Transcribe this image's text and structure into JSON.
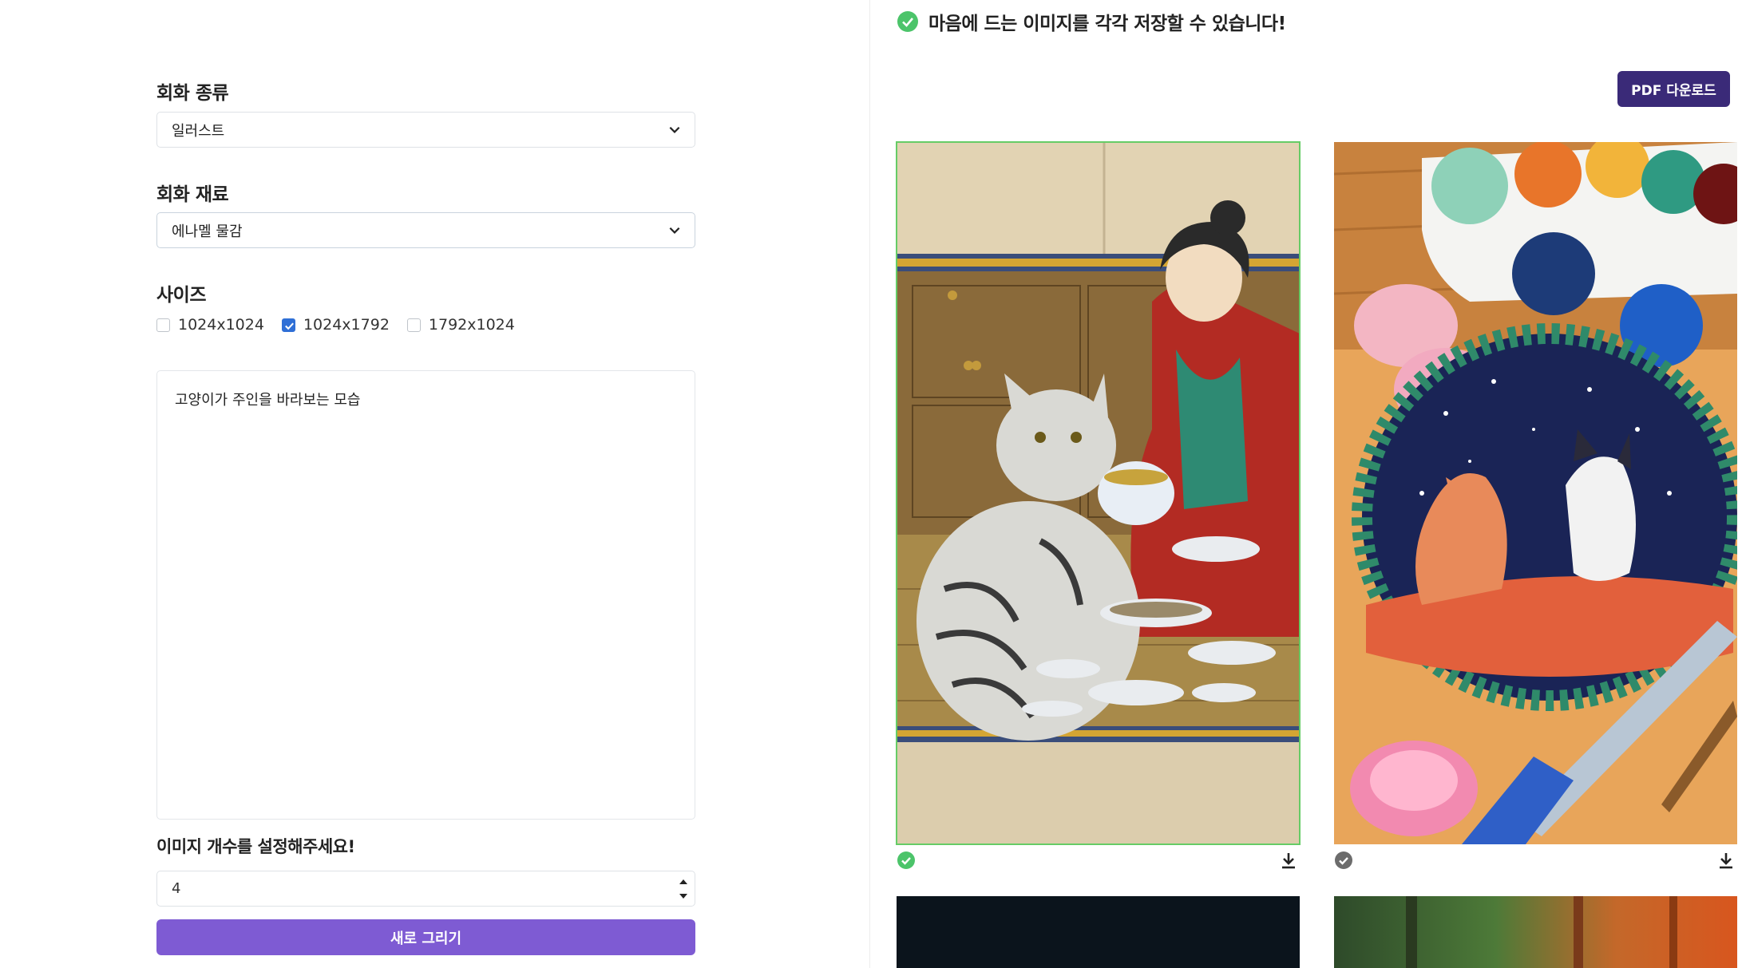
{
  "form": {
    "painting_type": {
      "label": "회화 종류",
      "value": "일러스트"
    },
    "painting_material": {
      "label": "회화 재료",
      "value": "에나멜 물감"
    },
    "size": {
      "label": "사이즈",
      "options": [
        {
          "label": "1024x1024",
          "checked": false
        },
        {
          "label": "1024x1792",
          "checked": true
        },
        {
          "label": "1792x1024",
          "checked": false
        }
      ]
    },
    "prompt": "고양이가 주인을 바라보는 모습",
    "image_count": {
      "label": "이미지 개수를 설정해주세요!",
      "value": "4"
    },
    "submit_label": "새로 그리기"
  },
  "results": {
    "notice": "마음에 드는 이미지를 각각 저장할 수 있습니다!",
    "pdf_button": "PDF 다운로드",
    "images": [
      {
        "selected": true,
        "status_icon": "check-circle-green-icon",
        "download_icon": "download-icon"
      },
      {
        "selected": false,
        "status_icon": "check-circle-gray-icon",
        "download_icon": "download-icon"
      },
      {
        "selected": false
      },
      {
        "selected": false
      }
    ]
  },
  "colors": {
    "primary_button": "#7e5bd3",
    "pdf_button": "#3a2a78",
    "success": "#4cc46a",
    "checkbox": "#2f6fd6"
  }
}
